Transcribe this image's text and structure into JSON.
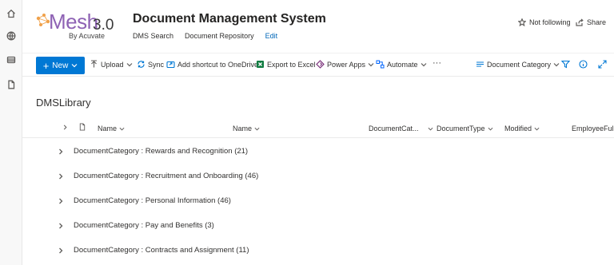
{
  "logo": {
    "word": "Mesh",
    "version": "3.0",
    "by": "By Acuvate"
  },
  "site": {
    "title": "Document Management System",
    "nav": [
      "DMS Search",
      "Document Repository",
      "Edit"
    ]
  },
  "header_actions": {
    "follow_label": "Not following",
    "share_label": "Share"
  },
  "commands": {
    "new_label": "New",
    "upload_label": "Upload",
    "sync_label": "Sync",
    "shortcut_label": "Add shortcut to OneDrive",
    "export_label": "Export to Excel",
    "powerapps_label": "Power Apps",
    "automate_label": "Automate",
    "more_label": "···",
    "view_label": "Document Category"
  },
  "library": {
    "title": "DMSLibrary"
  },
  "columns": [
    "Name",
    "Name",
    "DocumentCat...",
    "DocumentType",
    "Modified",
    "EmployeeFullN"
  ],
  "groups": [
    "DocumentCategory : Rewards and Recognition (21)",
    "DocumentCategory : Recruitment and Onboarding (46)",
    "DocumentCategory : Personal Information (46)",
    "DocumentCategory : Pay and Benefits (3)",
    "DocumentCategory : Contracts and Assignment (11)"
  ],
  "colors": {
    "accent": "#0078d4",
    "brand": "#8e62b4",
    "excel": "#107c41"
  },
  "icons": [
    "home-icon",
    "globe-icon",
    "database-icon",
    "document-icon",
    "star-icon",
    "share-icon",
    "upload-icon",
    "sync-icon",
    "shortcut-icon",
    "excel-icon",
    "power-apps-icon",
    "automate-icon",
    "view-icon",
    "filter-icon",
    "info-icon",
    "expand-icon"
  ]
}
